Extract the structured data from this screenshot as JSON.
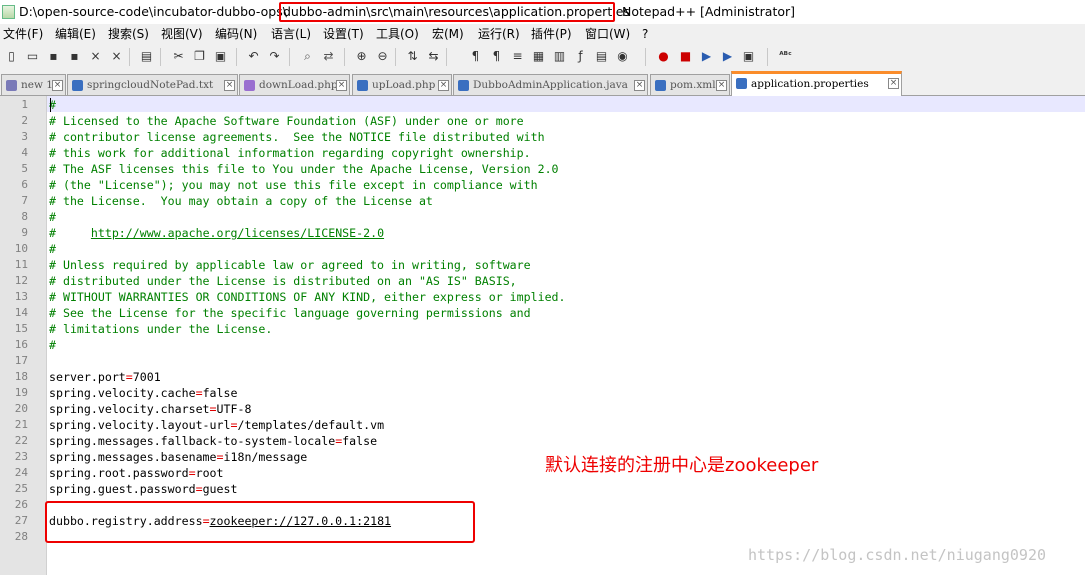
{
  "titlebar": {
    "path_prefix": "D:\\open-source-code\\incubator-dubbo-ops\\",
    "path_highlight": "dubbo-admin\\src\\main\\resources\\application.properties",
    "app_suffix": "Notepad++ [Administrator]"
  },
  "menu": [
    "文件(F)",
    "编辑(E)",
    "搜索(S)",
    "视图(V)",
    "编码(N)",
    "语言(L)",
    "设置(T)",
    "工具(O)",
    "宏(M)",
    "运行(R)",
    "插件(P)",
    "窗口(W)",
    "?"
  ],
  "toolbar_icons": [
    "new-file-icon",
    "open-file-icon",
    "save-icon",
    "save-all-icon",
    "close-icon",
    "close-all-icon",
    "print-icon",
    "cut-icon",
    "copy-icon",
    "paste-icon",
    "undo-icon",
    "redo-icon",
    "find-icon",
    "replace-icon",
    "zoom-in-icon",
    "zoom-out-icon",
    "sync-vertical-icon",
    "sync-horizontal-icon",
    "word-wrap-icon",
    "show-all-chars-icon",
    "indent-guide-icon",
    "user-language-icon",
    "doc-map-icon",
    "function-list-icon",
    "folder-workspace-icon",
    "monitoring-icon",
    "record-macro-icon",
    "stop-record-icon",
    "play-macro-icon",
    "run-macro-multiple-icon",
    "save-macro-icon",
    "spell-check-icon"
  ],
  "tabs": [
    {
      "label": "new 1",
      "active": false
    },
    {
      "label": "springcloudNotePad.txt",
      "active": false
    },
    {
      "label": "downLoad.php",
      "active": false
    },
    {
      "label": "upLoad.php",
      "active": false
    },
    {
      "label": "DubboAdminApplication.java",
      "active": false
    },
    {
      "label": "pom.xml",
      "active": false
    },
    {
      "label": "application.properties",
      "active": true
    }
  ],
  "lines": [
    {
      "n": "1",
      "text": "#"
    },
    {
      "n": "2",
      "text": "# Licensed to the Apache Software Foundation (ASF) under one or more"
    },
    {
      "n": "3",
      "text": "# contributor license agreements.  See the NOTICE file distributed with"
    },
    {
      "n": "4",
      "text": "# this work for additional information regarding copyright ownership."
    },
    {
      "n": "5",
      "text": "# The ASF licenses this file to You under the Apache License, Version 2.0"
    },
    {
      "n": "6",
      "text": "# (the \"License\"); you may not use this file except in compliance with"
    },
    {
      "n": "7",
      "text": "# the License.  You may obtain a copy of the License at"
    },
    {
      "n": "8",
      "text": "#"
    },
    {
      "n": "9",
      "text": "#     http://www.apache.org/licenses/LICENSE-2.0"
    },
    {
      "n": "10",
      "text": "#"
    },
    {
      "n": "11",
      "text": "# Unless required by applicable law or agreed to in writing, software"
    },
    {
      "n": "12",
      "text": "# distributed under the License is distributed on an \"AS IS\" BASIS,"
    },
    {
      "n": "13",
      "text": "# WITHOUT WARRANTIES OR CONDITIONS OF ANY KIND, either express or implied."
    },
    {
      "n": "14",
      "text": "# See the License for the specific language governing permissions and"
    },
    {
      "n": "15",
      "text": "# limitations under the License."
    },
    {
      "n": "16",
      "text": "#"
    },
    {
      "n": "17",
      "text": ""
    },
    {
      "n": "18",
      "text": "server.port=7001"
    },
    {
      "n": "19",
      "text": "spring.velocity.cache=false"
    },
    {
      "n": "20",
      "text": "spring.velocity.charset=UTF-8"
    },
    {
      "n": "21",
      "text": "spring.velocity.layout-url=/templates/default.vm"
    },
    {
      "n": "22",
      "text": "spring.messages.fallback-to-system-locale=false"
    },
    {
      "n": "23",
      "text": "spring.messages.basename=i18n/message"
    },
    {
      "n": "24",
      "text": "spring.root.password=root"
    },
    {
      "n": "25",
      "text": "spring.guest.password=guest"
    },
    {
      "n": "26",
      "text": ""
    },
    {
      "n": "27",
      "text": "dubbo.registry.address=zookeeper://127.0.0.1:2181"
    },
    {
      "n": "28",
      "text": ""
    }
  ],
  "annotation": "默认连接的注册中心是zookeeper",
  "watermark": "https://blog.csdn.net/niugang0920",
  "colors": {
    "comment": "#008000",
    "operator": "#e00000",
    "highlight_box": "#e00000",
    "active_tab_accent": "#fa8c2a",
    "gutter": "#e4e4e4"
  }
}
